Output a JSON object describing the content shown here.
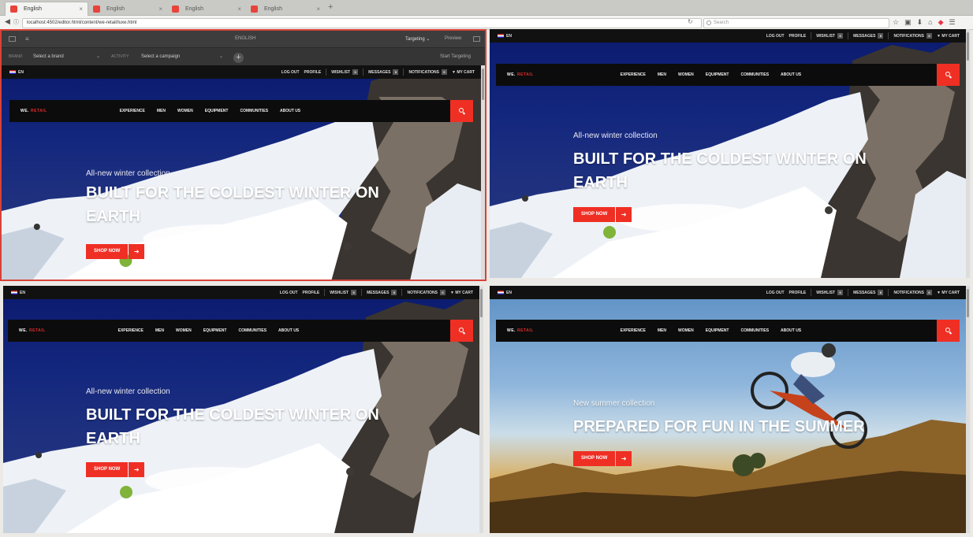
{
  "browser": {
    "tabs": [
      {
        "label": "English",
        "close": "×"
      },
      {
        "label": "English",
        "close": "×"
      },
      {
        "label": "English",
        "close": "×"
      },
      {
        "label": "English",
        "close": "×"
      }
    ],
    "new_tab": "+",
    "url": "localhost:4502/editor.html/content/we-retail/luxe.html",
    "search_placeholder": "Search",
    "toolbar_icons": [
      "star-icon",
      "reader-icon",
      "download-icon",
      "home-icon",
      "pocket-icon",
      "menu-icon"
    ]
  },
  "editor": {
    "language": "ENGLISH",
    "mode": "Targeting",
    "preview": "Preview",
    "brand_label": "BRAND",
    "brand_value": "Select a brand",
    "activity_label": "ACTIVITY",
    "activity_value": "Select a campaign",
    "start_targeting": "Start Targeting"
  },
  "site": {
    "lang": "EN",
    "topbar": {
      "logout": "LOG OUT",
      "profile": "PROFILE",
      "wishlist": "WISHLIST",
      "messages": "MESSAGES",
      "notifications": "NOTIFICATIONS",
      "cart": "MY CART",
      "count": "0"
    },
    "logo": "WE.",
    "logo_accent": "RETAIL",
    "menu": [
      "EXPERIENCE",
      "MEN",
      "WOMEN",
      "EQUIPMENT",
      "COMMUNITIES",
      "ABOUT US"
    ]
  },
  "panes": [
    {
      "sub": "All-new winter collection",
      "title_line1": "BUILT FOR THE COLDEST WINTER ON",
      "title_line2": "EARTH",
      "cta": "SHOP NOW"
    },
    {
      "sub": "All-new winter collection",
      "title_line1": "BUILT FOR THE COLDEST WINTER ON",
      "title_line2": "EARTH",
      "cta": "SHOP NOW"
    },
    {
      "sub": "All-new winter collection",
      "title_line1": "BUILT FOR THE COLDEST WINTER ON",
      "title_line2": "EARTH",
      "cta": "SHOP NOW"
    },
    {
      "sub": "New summer collection",
      "title_line1": "PREPARED FOR FUN IN THE SUMMER",
      "title_line2": "",
      "cta": "SHOP NOW"
    }
  ],
  "colors": {
    "accent": "#ef2f24",
    "navbar": "#0c0c0c",
    "editor_border": "#d94237"
  }
}
